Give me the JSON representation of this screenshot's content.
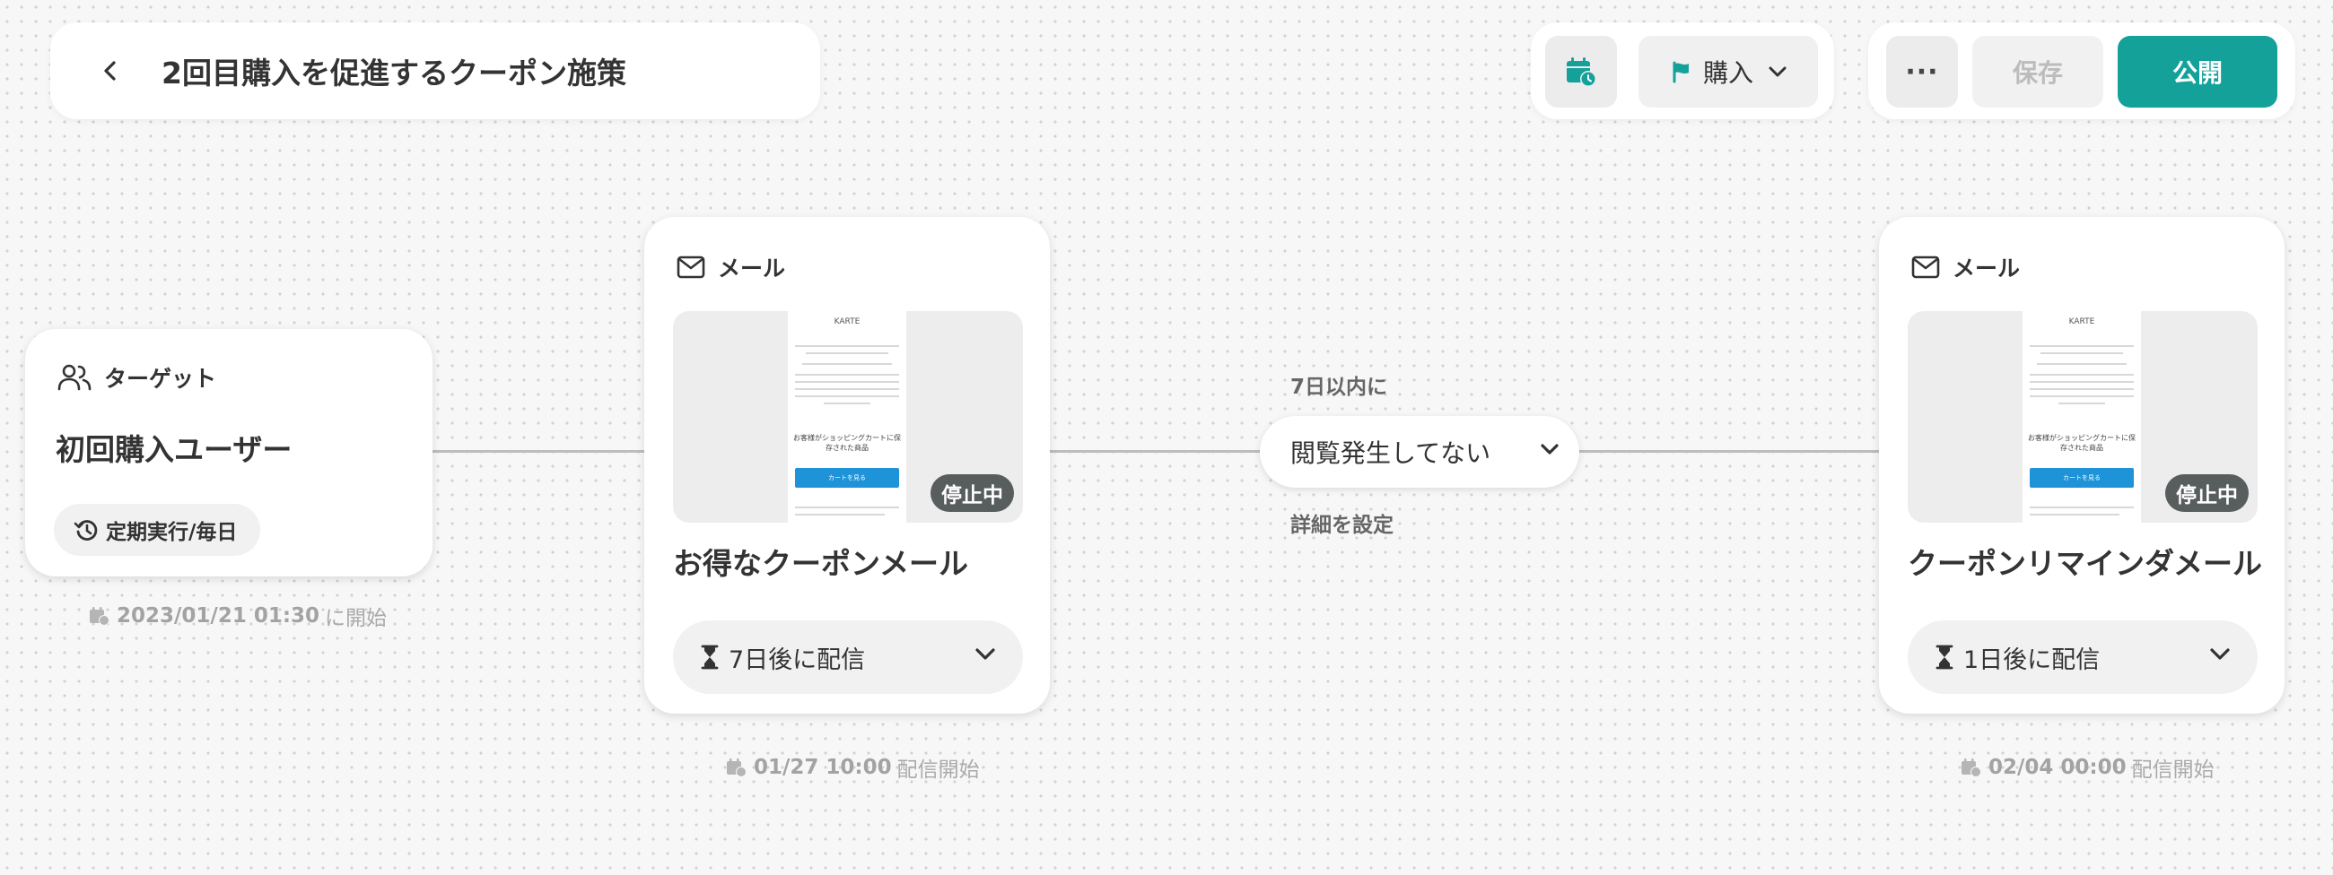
{
  "header": {
    "back_label": "戻る",
    "title": "2回目購入を促進するクーポン施策"
  },
  "toolbar": {
    "goal_label": "購入",
    "more_label": "···",
    "save_label": "保存",
    "publish_label": "公開"
  },
  "target_node": {
    "type_label": "ターゲット",
    "title": "初回購入ユーザー",
    "schedule_label": "定期実行/毎日",
    "start_datetime": "2023/01/21 01:30",
    "start_suffix": "に開始"
  },
  "mail_nodes": [
    {
      "type_label": "メール",
      "status": "停止中",
      "title": "お得なクーポンメール",
      "delay_label": "7日後に配信",
      "send_datetime": "01/27 10:00",
      "send_suffix": "配信開始"
    },
    {
      "type_label": "メール",
      "status": "停止中",
      "title": "クーポンリマインダメール",
      "delay_label": "1日後に配信",
      "send_datetime": "02/04 00:00",
      "send_suffix": "配信開始"
    }
  ],
  "email_preview": {
    "logo": "KARTE",
    "product_heading": "お客様がショッピングカートに保存された商品",
    "cta": "カートを見る"
  },
  "condition": {
    "window_label": "7日以内に",
    "selected": "閲覧発生してない",
    "detail_link": "詳細を設定"
  },
  "colors": {
    "primary": "#14a19a",
    "badge": "#585d5d",
    "connector": "#bdbdbd"
  }
}
